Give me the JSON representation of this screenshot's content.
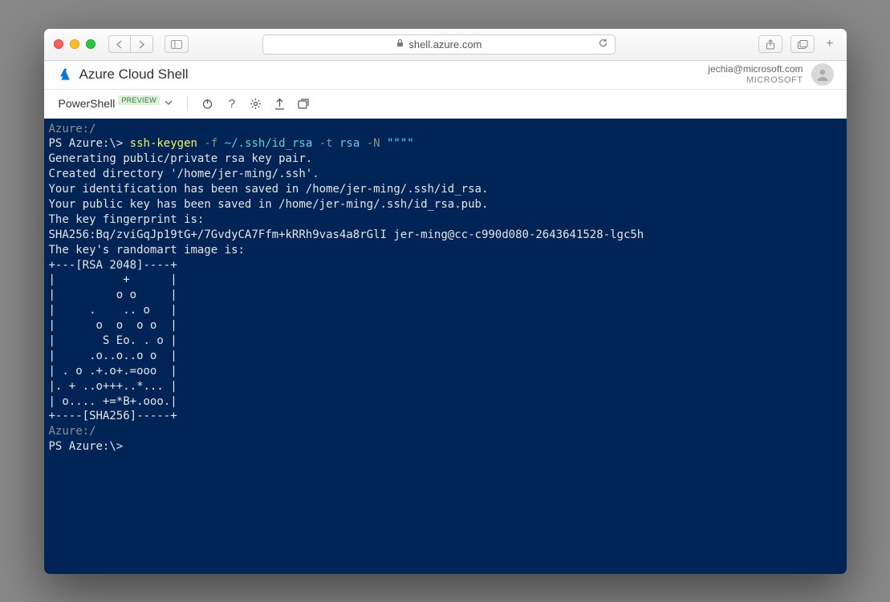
{
  "browser": {
    "url_host": "shell.azure.com"
  },
  "app": {
    "title": "Azure Cloud Shell",
    "user_email": "jechia@microsoft.com",
    "user_org": "MICROSOFT"
  },
  "toolbar": {
    "shell_name": "PowerShell",
    "preview_label": "PREVIEW"
  },
  "terminal": {
    "line01_path": "Azure:/",
    "line02_prompt": "PS Azure:\\> ",
    "line02_cmd": "ssh-keygen",
    "line02_flag1": " -f",
    "line02_arg1": " ~/.ssh/id_rsa",
    "line02_flag2": " -t",
    "line02_arg2": " rsa",
    "line02_flag3": " -N",
    "line02_arg3": " \"\"\"\"",
    "line03": "Generating public/private rsa key pair.",
    "line04": "Created directory '/home/jer-ming/.ssh'.",
    "line05": "Your identification has been saved in /home/jer-ming/.ssh/id_rsa.",
    "line06": "Your public key has been saved in /home/jer-ming/.ssh/id_rsa.pub.",
    "line07": "The key fingerprint is:",
    "line08": "SHA256:Bq/zviGqJp19tG+/7GvdyCA7Ffm+kRRh9vas4a8rGlI jer-ming@cc-c990d080-2643641528-lgc5h",
    "line09": "The key's randomart image is:",
    "art01": "+---[RSA 2048]----+",
    "art02": "|          +      |",
    "art03": "|         o o     |",
    "art04": "|     .    .. o   |",
    "art05": "|      o  o  o o  |",
    "art06": "|       S Eo. . o |",
    "art07": "|     .o..o..o o  |",
    "art08": "| . o .+.o+.=ooo  |",
    "art09": "|. + ..o+++..*... |",
    "art10": "| o.... +=*B+.ooo.|",
    "art11": "+----[SHA256]-----+",
    "line_end_path": "Azure:/",
    "line_end_prompt": "PS Azure:\\>"
  }
}
